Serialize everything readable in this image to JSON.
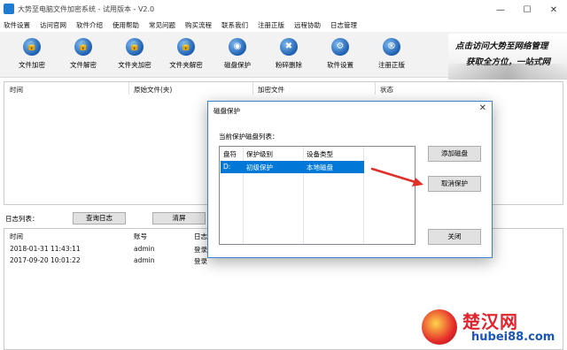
{
  "window": {
    "title": "大势至电脑文件加密系统 - 试用版本 - V2.0"
  },
  "menu": [
    "软件设置",
    "访问官网",
    "软件介绍",
    "使用帮助",
    "常见问题",
    "购买流程",
    "联系我们",
    "注册正版",
    "远程协助",
    "日志管理"
  ],
  "toolbar": [
    {
      "label": "文件加密",
      "icon": "file-encrypt-icon"
    },
    {
      "label": "文件解密",
      "icon": "file-decrypt-icon"
    },
    {
      "label": "文件夹加密",
      "icon": "folder-encrypt-icon"
    },
    {
      "label": "文件夹解密",
      "icon": "folder-decrypt-icon"
    },
    {
      "label": "磁盘保护",
      "icon": "disk-protect-icon"
    },
    {
      "label": "粉碎删除",
      "icon": "shred-delete-icon"
    },
    {
      "label": "软件设置",
      "icon": "gear-icon"
    },
    {
      "label": "注册正版",
      "icon": "register-icon"
    }
  ],
  "banner": {
    "line1": "点击访问大势至网络管理",
    "line2": "获取全方位，一站式网"
  },
  "main_list": {
    "columns": [
      "时间",
      "原始文件(夹)",
      "加密文件",
      "状态"
    ]
  },
  "log": {
    "label": "日志列表：",
    "query_button": "查询日志",
    "clear_button": "清屏",
    "columns": [
      "时间",
      "账号",
      "日志"
    ],
    "rows": [
      {
        "time": "2018-01-31 11:43:11",
        "account": "admin",
        "log": "登录"
      },
      {
        "time": "2017-09-20 10:01:22",
        "account": "admin",
        "log": "登录"
      }
    ]
  },
  "dialog": {
    "title": "磁盘保护",
    "list_label": "当前保护磁盘列表：",
    "columns": [
      "盘符",
      "保护级别",
      "设备类型"
    ],
    "rows": [
      {
        "drive": "D:",
        "level": "初级保护",
        "type": "本地磁盘"
      }
    ],
    "add_button": "添加磁盘",
    "cancel_button": "取消保护",
    "close_button": "关闭"
  },
  "watermark": {
    "text": "楚汉网",
    "url": "hubei88.com"
  },
  "colors": {
    "accent": "#0078d7",
    "arrow": "#e0302a",
    "watermark_red": "#e3232b",
    "watermark_blue": "#1a55b8"
  }
}
